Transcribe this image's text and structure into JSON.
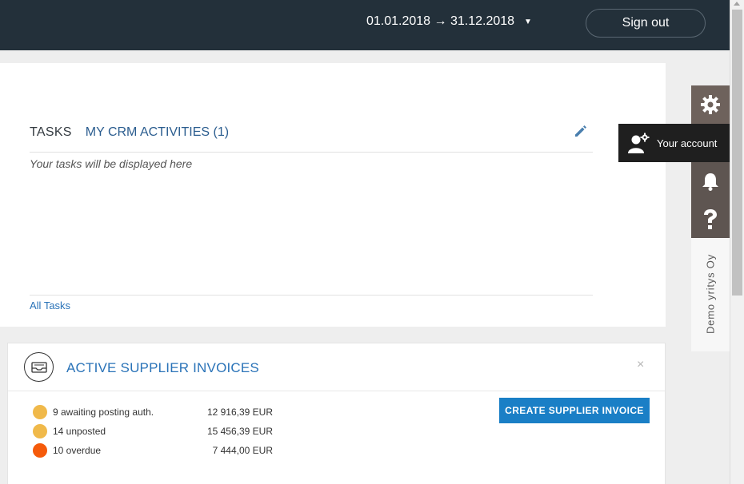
{
  "header": {
    "date_range": "01.01.2018 → 31.12.2018",
    "date_range_caret": "▼",
    "sign_out_label": "Sign out"
  },
  "tasks": {
    "title": "TASKS",
    "crm_tab": "MY CRM ACTIVITIES (1)",
    "empty_message": "Your tasks will be displayed here",
    "all_tasks_link": "All Tasks"
  },
  "supplier_invoices": {
    "title": "ACTIVE SUPPLIER INVOICES",
    "close_label": "×",
    "create_button": "CREATE SUPPLIER INVOICE",
    "rows": [
      {
        "label": "9 awaiting posting auth.",
        "amount": "12 916,39 EUR",
        "color": "#f0b94a"
      },
      {
        "label": "14 unposted",
        "amount": "15 456,39 EUR",
        "color": "#f0b94a"
      },
      {
        "label": "10 overdue",
        "amount": "7 444,00 EUR",
        "color": "#f55a0a"
      }
    ]
  },
  "side_panel": {
    "items": [
      "gear-icon",
      "user-settings-icon",
      "bell-icon",
      "question-icon"
    ],
    "tooltip": "Your account",
    "company": "Demo yritys Oy"
  },
  "colors": {
    "topbar": "#23303a",
    "accent_blue": "#2a73b8",
    "button_blue": "#1a7fc6",
    "side_panel": "#5e5551"
  }
}
